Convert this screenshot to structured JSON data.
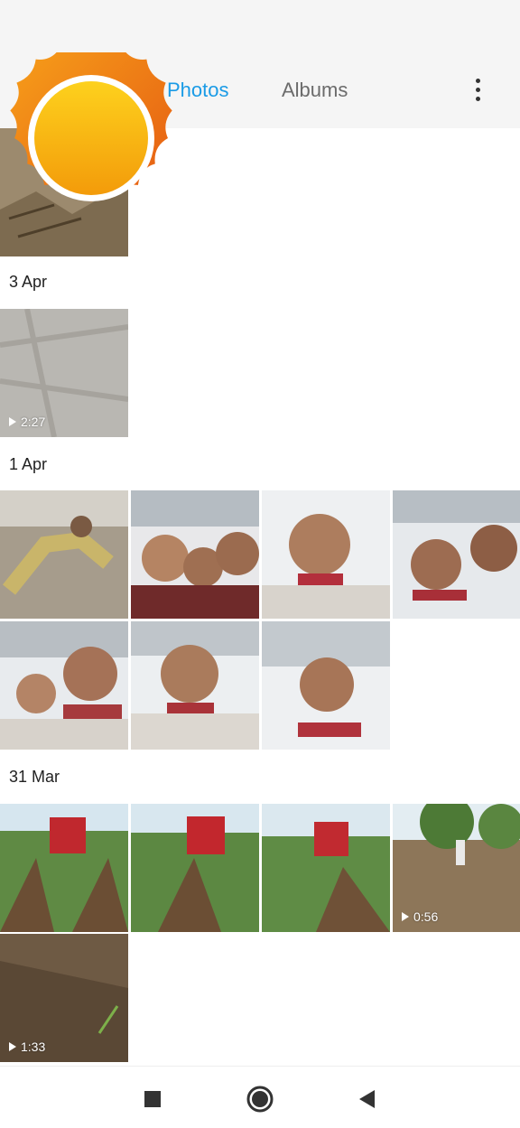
{
  "header": {
    "tabs": [
      {
        "label": "Photos",
        "active": true
      },
      {
        "label": "Albums",
        "active": false
      }
    ],
    "accent_color": "#1a9be6",
    "more_icon": "more-vertical-icon"
  },
  "sticker": {
    "icon": "sun-badge-icon"
  },
  "sections": [
    {
      "date": "",
      "items": [
        {
          "type": "photo"
        }
      ]
    },
    {
      "date": "3 Apr",
      "items": [
        {
          "type": "video",
          "duration": "2:27"
        }
      ]
    },
    {
      "date": "1 Apr",
      "items": [
        {
          "type": "photo"
        },
        {
          "type": "photo"
        },
        {
          "type": "photo"
        },
        {
          "type": "photo"
        },
        {
          "type": "photo"
        },
        {
          "type": "photo"
        },
        {
          "type": "photo"
        }
      ]
    },
    {
      "date": "31 Mar",
      "items": [
        {
          "type": "photo"
        },
        {
          "type": "photo"
        },
        {
          "type": "photo"
        },
        {
          "type": "video",
          "duration": "0:56"
        },
        {
          "type": "video",
          "duration": "1:33"
        }
      ]
    }
  ],
  "nav": {
    "recents_icon": "recents-square-icon",
    "home_icon": "home-circle-icon",
    "back_icon": "back-triangle-icon"
  }
}
